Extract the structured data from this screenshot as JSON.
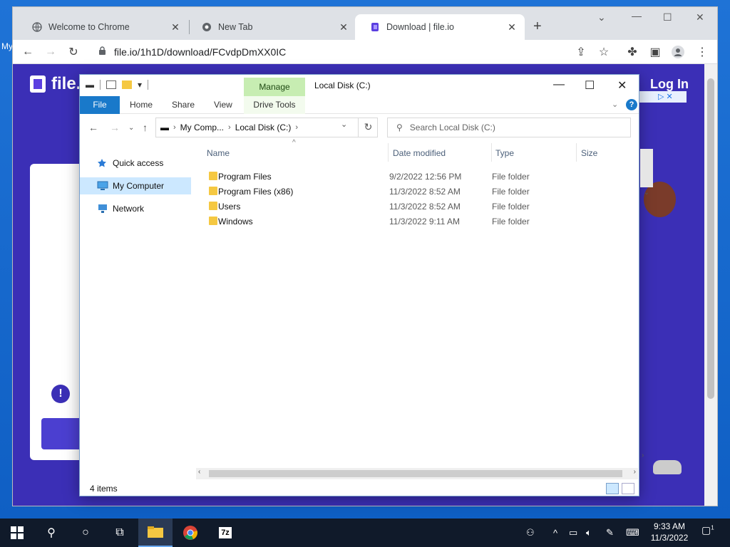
{
  "desktop": {
    "label": "My"
  },
  "chrome": {
    "tabs": [
      {
        "label": "Welcome to Chrome",
        "icon": "globe-icon"
      },
      {
        "label": "New Tab",
        "icon": "chrome-icon"
      },
      {
        "label": "Download | file.io",
        "icon": "fileio-icon"
      }
    ],
    "url": "file.io/1h1D/download/FCvdpDmXX0IC"
  },
  "page": {
    "brand": "file.",
    "login": "Log In",
    "alert": "!"
  },
  "explorer": {
    "contextual_group": "Manage",
    "title": "Local Disk (C:)",
    "ribbon_tabs": [
      "File",
      "Home",
      "Share",
      "View",
      "Drive Tools"
    ],
    "breadcrumb": [
      "My Comp...",
      "Local Disk (C:)"
    ],
    "search_placeholder": "Search Local Disk (C:)",
    "nav": [
      {
        "label": "Quick access",
        "icon": "star-icon",
        "selected": false
      },
      {
        "label": "My Computer",
        "icon": "computer-icon",
        "selected": true
      },
      {
        "label": "Network",
        "icon": "network-icon",
        "selected": false
      }
    ],
    "columns": [
      "Name",
      "Date modified",
      "Type",
      "Size"
    ],
    "files": [
      {
        "name": "Program Files",
        "date": "9/2/2022 12:56 PM",
        "type": "File folder"
      },
      {
        "name": "Program Files (x86)",
        "date": "11/3/2022 8:52 AM",
        "type": "File folder"
      },
      {
        "name": "Users",
        "date": "11/3/2022 8:52 AM",
        "type": "File folder"
      },
      {
        "name": "Windows",
        "date": "11/3/2022 9:11 AM",
        "type": "File folder"
      }
    ],
    "status": "4 items"
  },
  "taskbar": {
    "time": "9:33 AM",
    "date": "11/3/2022",
    "notifications": "1"
  }
}
